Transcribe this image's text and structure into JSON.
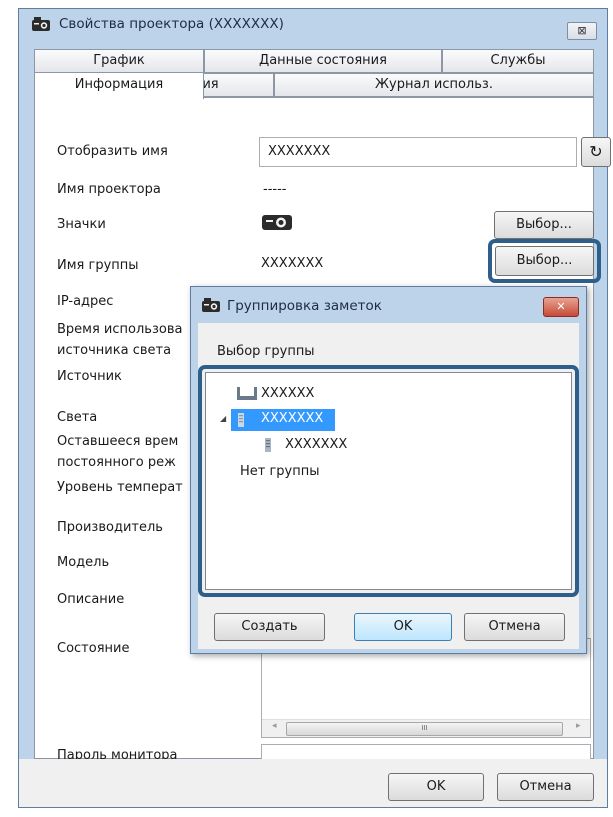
{
  "window": {
    "title": "Свойства проектора (XXXXXXX)",
    "close_glyph": "⊠"
  },
  "tabs_row1": [
    {
      "label": "График"
    },
    {
      "label": "Данные состояния"
    },
    {
      "label": "Службы"
    }
  ],
  "tabs_row2": [
    {
      "label": "Информация"
    },
    {
      "label": "Журнал состояния"
    },
    {
      "label": "Журнал использ."
    }
  ],
  "info": {
    "display_name_label": "Отобразить имя",
    "display_name_value": "XXXXXXX",
    "refresh_glyph": "↻",
    "projector_name_label": "Имя проектора",
    "projector_name_value": "-----",
    "icons_label": "Значки",
    "select_button": "Выбор...",
    "group_name_label": "Имя группы",
    "group_name_value": "XXXXXXX",
    "ip_label": "IP-адрес",
    "usage_time_label_1": "Время использова",
    "usage_time_label_2": "источника света",
    "source_label": "Источник",
    "light_label": "Света",
    "remaining_label_1": "Оставшееся врем",
    "remaining_label_2": "постоянного реж",
    "temp_label": "Уровень температ",
    "manufacturer_label": "Производитель",
    "model_label": "Модель",
    "description_label": "Описание",
    "status_label": "Состояние",
    "monitor_password_label": "Пароль монитора",
    "scroll_thumb_glyph": "III",
    "scroll_left_glyph": "◂",
    "scroll_right_glyph": "▸"
  },
  "dialog": {
    "title": "Группировка заметок",
    "close_glyph": "✕",
    "select_group_label": "Выбор группы",
    "tree": {
      "item1": "XXXXXX",
      "expand_glyph": "◢",
      "item2_selected": "XXXXXXX",
      "item3_child": "XXXXXXX",
      "no_group": "Нет группы"
    },
    "create_button": "Создать",
    "ok_button": "OK",
    "cancel_button": "Отмена"
  },
  "footer": {
    "ok_button": "OK",
    "cancel_button": "Отмена"
  }
}
